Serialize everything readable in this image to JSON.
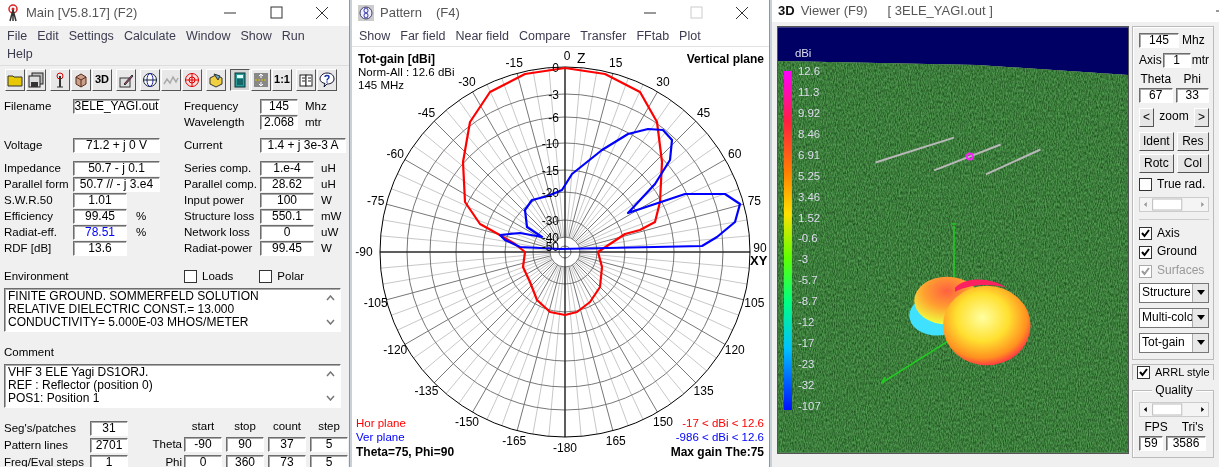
{
  "main": {
    "title": "Main [V5.8.17]  (F2)",
    "menu": [
      "File",
      "Edit",
      "Settings",
      "Calculate",
      "Window",
      "Show",
      "Run",
      "Help"
    ],
    "toolbar": [
      [
        {
          "kind": "folder",
          "selected": false
        },
        {
          "kind": "disks",
          "selected": false
        }
      ],
      [
        {
          "kind": "antenna",
          "selected": false
        },
        {
          "kind": "cube",
          "selected": false
        },
        {
          "kind": "text",
          "label": "3D",
          "selected": false
        }
      ],
      [
        {
          "kind": "pencil",
          "selected": false
        }
      ],
      [
        {
          "kind": "globe",
          "selected": false
        },
        {
          "kind": "wave",
          "selected": false
        },
        {
          "kind": "target",
          "selected": false
        }
      ],
      [
        {
          "kind": "box",
          "selected": false
        }
      ],
      [
        {
          "kind": "calculator",
          "selected": true
        },
        {
          "kind": "arrows",
          "selected": false
        },
        {
          "kind": "text",
          "label": "1:1",
          "selected": false
        }
      ],
      [
        {
          "kind": "book",
          "selected": false
        },
        {
          "kind": "help",
          "selected": false
        }
      ]
    ],
    "field_groups": [
      [
        {
          "left": {
            "label": "Filename",
            "value": "3ELE_YAGI.out",
            "kind": "long",
            "highlighted": false
          },
          "right": {
            "label": "Frequency",
            "value": "145",
            "unit": "Mhz",
            "kind": "tiny",
            "highlighted": false
          }
        },
        {
          "right": {
            "label": "Wavelength",
            "value": "2.068",
            "unit": "mtr",
            "kind": "tiny",
            "highlighted": false
          }
        }
      ],
      [
        {
          "left": {
            "label": "Voltage",
            "value": "71.2 + j 0 V",
            "kind": "long",
            "highlighted": false
          },
          "right": {
            "label": "Current",
            "value": "1.4 + j 3e-3 A",
            "kind": "long",
            "highlighted": false
          }
        }
      ],
      [
        {
          "left": {
            "label": "Impedance",
            "value": "50.7 - j 0.1",
            "kind": "long",
            "highlighted": false
          },
          "right": {
            "label": "Series comp.",
            "value": "1.e-4",
            "unit": "uH",
            "kind": "short",
            "highlighted": false
          }
        },
        {
          "left": {
            "label": "Parallel form",
            "value": "50.7 // - j 3.e4",
            "kind": "long",
            "highlighted": false
          },
          "right": {
            "label": "Parallel comp.",
            "value": "28.62",
            "unit": "uH",
            "kind": "short",
            "highlighted": false
          }
        },
        {
          "left": {
            "label": "S.W.R.50",
            "value": "1.01",
            "kind": "short",
            "highlighted": false
          },
          "right": {
            "label": "Input power",
            "value": "100",
            "unit": "W",
            "kind": "short",
            "highlighted": false
          }
        },
        {
          "left": {
            "label": "Efficiency",
            "value": "99.45",
            "unit": "%",
            "kind": "short",
            "highlighted": false
          },
          "right": {
            "label": "Structure loss",
            "value": "550.1",
            "unit": "mW",
            "kind": "short",
            "highlighted": false
          }
        },
        {
          "left": {
            "label": "Radiat-eff.",
            "value": "78.51",
            "unit": "%",
            "kind": "short",
            "highlighted": true
          },
          "right": {
            "label": "Network loss",
            "value": "0",
            "unit": "uW",
            "kind": "short",
            "highlighted": false
          }
        },
        {
          "left": {
            "label": "RDF [dB]",
            "value": "13.6",
            "kind": "short",
            "highlighted": false
          },
          "right": {
            "label": "Radiat-power",
            "value": "99.45",
            "unit": "W",
            "kind": "short",
            "highlighted": false
          }
        }
      ]
    ],
    "environment": {
      "label": "Environment",
      "options": [
        {
          "label": "Loads",
          "checked": false
        },
        {
          "label": "Polar",
          "checked": false
        }
      ],
      "lines": [
        "FINITE GROUND.  SOMMERFELD SOLUTION",
        "RELATIVE DIELECTRIC CONST.= 13.000",
        "CONDUCTIVITY= 5.000E-03 MHOS/METER"
      ]
    },
    "comment": {
      "label": "Comment",
      "lines": [
        "VHF 3 ELE Yagi DS1ORJ.",
        "REF : Reflector (position 0)",
        "POS1: Position 1"
      ]
    },
    "counts": [
      {
        "label": "Seg's/patches",
        "value": "31"
      },
      {
        "label": "Pattern lines",
        "value": "2701"
      },
      {
        "label": "Freq/Eval steps",
        "value": "1"
      }
    ],
    "sweep": {
      "columns": [
        "start",
        "stop",
        "count",
        "step"
      ],
      "rows": [
        {
          "label": "Theta",
          "values": [
            "-90",
            "90",
            "37",
            "5"
          ]
        },
        {
          "label": "Phi",
          "values": [
            "0",
            "360",
            "73",
            "5"
          ]
        }
      ]
    }
  },
  "pattern": {
    "title": "Pattern",
    "shortcut": "(F4)",
    "menu": [
      "Show",
      "Far field",
      "Near field",
      "Compare",
      "Transfer",
      "FFtab",
      "Plot"
    ],
    "plot": {
      "quantity": "Tot-gain [dBi]",
      "normalization": "Norm-All : 12.6 dBi",
      "frequency": "145 MHz",
      "plane": "Vertical plane",
      "angle_labels": [
        "0",
        "15",
        "30",
        "45",
        "60",
        "75",
        "90",
        "105",
        "120",
        "135",
        "150",
        "165",
        "-180",
        "-165",
        "-150",
        "-135",
        "-120",
        "-105",
        "-90",
        "-75",
        "-60",
        "-45",
        "-30",
        "-15"
      ],
      "ring_labels": [
        "0",
        "-3",
        "-6",
        "-10",
        "-15",
        "-20",
        "-30",
        "-40",
        "-50"
      ],
      "axis_top": "Z",
      "axis_right": "XY",
      "legend": [
        {
          "label": "Hor plane",
          "range": "-17 < dBi < 12.6",
          "color": "#ff0000"
        },
        {
          "label": "Ver plane",
          "range": "-986 < dBi < 12.6",
          "color": "#0000ff"
        }
      ],
      "cursor": "Theta=75, Phi=90",
      "max_gain": "Max gain The:75"
    }
  },
  "viewer": {
    "icon_text": "3D",
    "title": "Viewer (F9)",
    "file": "[  3ELE_YAGI.out ]",
    "scale_unit": "dBi",
    "scale_labels": [
      "12.6",
      "11.3",
      "9.92",
      "8.46",
      "6.91",
      "5.25",
      "3.46",
      "1.52",
      "-0.6",
      "-3",
      "-5.7",
      "-8.7",
      "-12",
      "-17",
      "-23",
      "-32",
      "-107"
    ],
    "frequency": {
      "value": "145",
      "unit": "Mhz"
    },
    "axis": {
      "label": "Axis",
      "value": "1",
      "unit": "mtr"
    },
    "angles": [
      {
        "label": "Theta",
        "value": "67"
      },
      {
        "label": "Phi",
        "value": "33"
      }
    ],
    "zoom": {
      "prev": "<",
      "label": "zoom",
      "next": ">"
    },
    "buttons": [
      "Ident",
      "Res",
      "Rotc",
      "Col"
    ],
    "true_rad": {
      "label": "True rad.",
      "checked": false
    },
    "display": [
      {
        "label": "Axis",
        "checked": true,
        "disabled": false
      },
      {
        "label": "Ground",
        "checked": true,
        "disabled": false
      },
      {
        "label": "Surfaces",
        "checked": true,
        "disabled": true
      }
    ],
    "selects": [
      "Structure",
      "Multi-colo",
      "Tot-gain"
    ],
    "arrl": {
      "label": "ARRL style",
      "checked": true
    },
    "quality": {
      "title": "Quality",
      "stats": [
        {
          "label": "FPS",
          "value": "59"
        },
        {
          "label": "Tri's",
          "value": "3586"
        }
      ]
    }
  }
}
